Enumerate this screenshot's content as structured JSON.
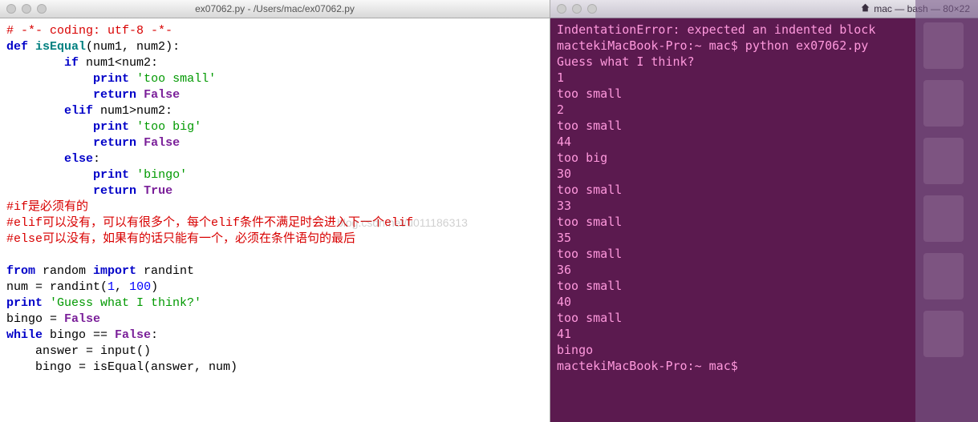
{
  "editor": {
    "title": "ex07062.py - /Users/mac/ex07062.py",
    "code": {
      "l1": "# -*- coding: utf-8 -*-",
      "l2a": "def",
      "l2b": "isEqual",
      "l2c": "(num1, num2):",
      "l3a": "if",
      "l3b": " num1<num2:",
      "l4a": "print",
      "l4b": "'too small'",
      "l5a": "return",
      "l5b": "False",
      "l6a": "elif",
      "l6b": " num1>num2:",
      "l7a": "print",
      "l7b": "'too big'",
      "l8a": "return",
      "l8b": "False",
      "l9a": "else",
      "l9b": ":",
      "l10a": "print",
      "l10b": "'bingo'",
      "l11a": "return",
      "l11b": "True",
      "l12": "#if是必须有的",
      "l13": "#elif可以没有，可以有很多个，每个elif条件不满足时会进入下一个elif",
      "l14": "#else可以没有，如果有的话只能有一个，必须在条件语句的最后",
      "l16a": "from",
      "l16b": " random ",
      "l16c": "import",
      "l16d": " randint",
      "l17a": "num = randint(",
      "l17b": "1",
      "l17c": ", ",
      "l17d": "100",
      "l17e": ")",
      "l18a": "print",
      "l18b": "'Guess what I think?'",
      "l19a": "bingo = ",
      "l19b": "False",
      "l20a": "while",
      "l20b": " bingo == ",
      "l20c": "False",
      "l20d": ":",
      "l21": "    answer = input()",
      "l22": "    bingo = isEqual(answer, num)"
    }
  },
  "terminal": {
    "title": "mac — bash — 80×22",
    "lines": [
      "IndentationError: expected an indented block",
      "mactekiMacBook-Pro:~ mac$ python ex07062.py",
      "Guess what I think?",
      "1",
      "too small",
      "2",
      "too small",
      "44",
      "too big",
      "30",
      "too small",
      "33",
      "too small",
      "35",
      "too small",
      "36",
      "too small",
      "40",
      "too small",
      "41",
      "bingo",
      "mactekiMacBook-Pro:~ mac$ "
    ]
  },
  "watermark": "blog.csdn.net/u011186313"
}
